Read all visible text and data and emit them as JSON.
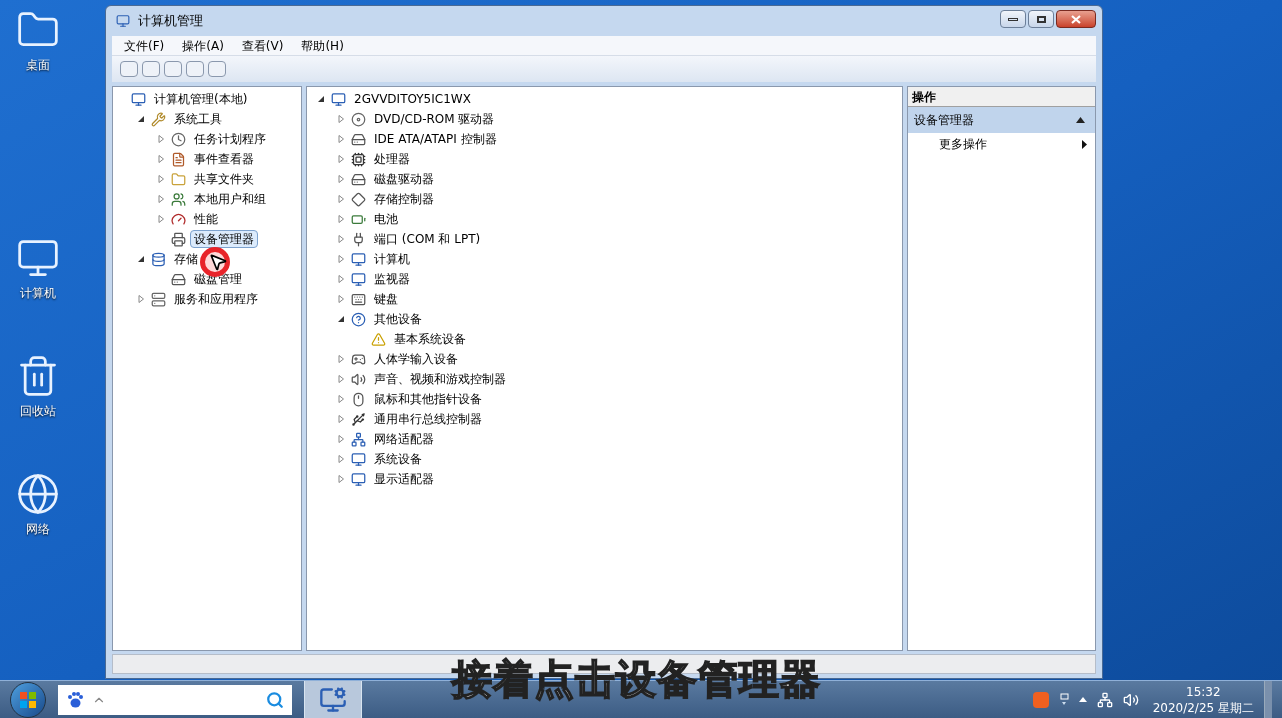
{
  "desktop_icons": [
    {
      "label": "桌面"
    },
    {
      "label": "计算机"
    },
    {
      "label": "回收站"
    },
    {
      "label": "网络"
    }
  ],
  "window": {
    "title": "计算机管理"
  },
  "menu": [
    "文件(F)",
    "操作(A)",
    "查看(V)",
    "帮助(H)"
  ],
  "nav_tree": [
    {
      "label": "计算机管理(本地)",
      "selected": false,
      "children": [
        {
          "label": "系统工具",
          "expanded": true,
          "selected": false,
          "children": [
            {
              "label": "任务计划程序",
              "expanded": false,
              "selected": false
            },
            {
              "label": "事件查看器",
              "expanded": false,
              "selected": false
            },
            {
              "label": "共享文件夹",
              "expanded": false,
              "selected": false
            },
            {
              "label": "本地用户和组",
              "expanded": false,
              "selected": false
            },
            {
              "label": "性能",
              "expanded": false,
              "selected": false
            },
            {
              "label": "设备管理器",
              "selected": true
            }
          ]
        },
        {
          "label": "存储",
          "expanded": true,
          "selected": false,
          "children": [
            {
              "label": "磁盘管理",
              "selected": false
            }
          ]
        },
        {
          "label": "服务和应用程序",
          "expanded": false,
          "selected": false
        }
      ]
    }
  ],
  "device_tree": [
    {
      "label": "2GVVDITOY5IC1WX",
      "expanded": true,
      "selected": false,
      "children": [
        {
          "label": "DVD/CD-ROM 驱动器",
          "expanded": false,
          "selected": false
        },
        {
          "label": "IDE ATA/ATAPI 控制器",
          "expanded": false,
          "selected": false
        },
        {
          "label": "处理器",
          "expanded": false,
          "selected": false
        },
        {
          "label": "磁盘驱动器",
          "expanded": false,
          "selected": false
        },
        {
          "label": "存储控制器",
          "expanded": false,
          "selected": false
        },
        {
          "label": "电池",
          "expanded": false,
          "selected": false
        },
        {
          "label": "端口 (COM 和 LPT)",
          "expanded": false,
          "selected": false
        },
        {
          "label": "计算机",
          "expanded": false,
          "selected": false
        },
        {
          "label": "监视器",
          "expanded": false,
          "selected": false
        },
        {
          "label": "键盘",
          "expanded": false,
          "selected": false
        },
        {
          "label": "其他设备",
          "expanded": true,
          "selected": false,
          "children": [
            {
              "label": "基本系统设备",
              "selected": false
            }
          ]
        },
        {
          "label": "人体学输入设备",
          "expanded": false,
          "selected": false
        },
        {
          "label": "声音、视频和游戏控制器",
          "expanded": false,
          "selected": false
        },
        {
          "label": "鼠标和其他指针设备",
          "expanded": false,
          "selected": false
        },
        {
          "label": "通用串行总线控制器",
          "expanded": false,
          "selected": false
        },
        {
          "label": "网络适配器",
          "expanded": false,
          "selected": false
        },
        {
          "label": "系统设备",
          "expanded": false,
          "selected": false
        },
        {
          "label": "显示适配器",
          "expanded": false,
          "selected": false
        }
      ]
    }
  ],
  "actions": {
    "header": "操作",
    "section": {
      "title": "设备管理器",
      "expanded": true
    },
    "items": [
      "更多操作"
    ]
  },
  "subtitle": "接着点击设备管理器",
  "taskbar": {
    "time": "15:32",
    "date": "2020/2/25 星期二"
  }
}
